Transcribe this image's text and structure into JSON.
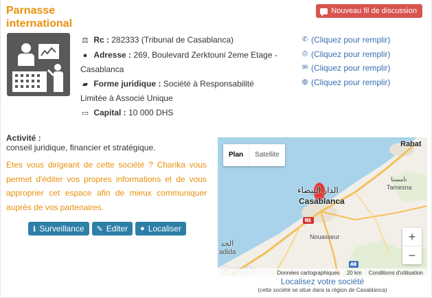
{
  "company": {
    "name": "Parnasse international"
  },
  "header": {
    "new_thread_label": "Nouveau fil de discussion"
  },
  "info": {
    "rc_label": "Rc :",
    "rc_value": "282333 (Tribunal de Casablanca)",
    "address_label": "Adresse :",
    "address_value": "269, Boulevard Zerktouni 2eme Etage - Casablanca",
    "legal_form_label": "Forme juridique :",
    "legal_form_value": "Société à Responsabilité Limitée à Associé Unique",
    "capital_label": "Capital :",
    "capital_value": "10 000 DHS"
  },
  "contacts": {
    "phone": "(Cliquez pour remplir)",
    "fax": "(Cliquez pour remplir)",
    "email": "(Cliquez pour remplir)",
    "website": "(Cliquez pour remplir)"
  },
  "activity": {
    "title": "Activité :",
    "text": "conseil juridique, financier et stratégique."
  },
  "promo": "Etes vous dirigeant de cette société ? Charika vous permet d'éditer vos propres informations et de vous approprier cet espace afin de mieux communiquer auprès de vos partenaires.",
  "actions": {
    "surveillance": "Surveillance",
    "edit": "Editer",
    "localize": "Localiser"
  },
  "map": {
    "plan_label": "Plan",
    "satellite_label": "Satellite",
    "zoom_in": "+",
    "zoom_out": "−",
    "city_main": "Casablanca",
    "city_main_arabic": "الدار البيضاء",
    "rabat": "Rabat",
    "tamesna": "Tamesna",
    "tamesna_arabic": "تامسنا",
    "nouasseur": "Nouasseur",
    "el_jadida_arabic": "الجد",
    "jadida_partial": "adida",
    "road_n1": "N1",
    "road_a8": "A8",
    "google": "Google",
    "footer_data": "Données cartographiques",
    "footer_scale": "20 km",
    "footer_terms": "Conditions d'utilisation",
    "colors": {
      "water": "#a9d3ea",
      "land": "#f2efe9",
      "road": "#f4c05a",
      "pin": "#e53935"
    }
  },
  "localize_link": "Localisez votre société",
  "region_note": "(cette société se situe dans la région de Casablanca)"
}
